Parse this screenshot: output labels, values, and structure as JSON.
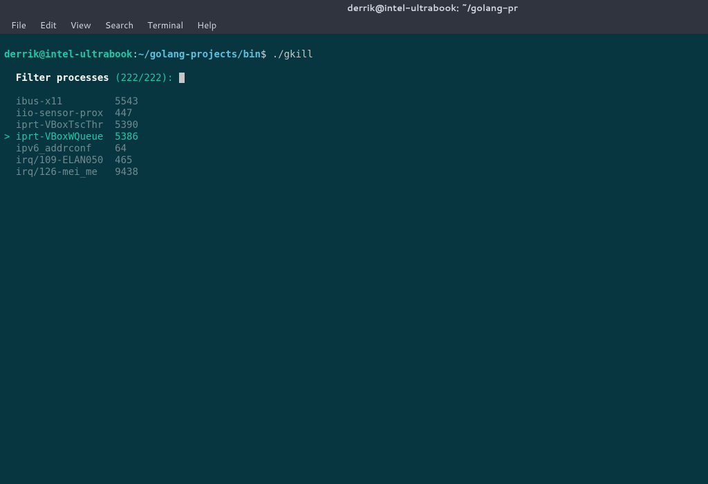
{
  "titlebar": {
    "text": "derrik@intel-ultrabook: ~/golang-pr"
  },
  "menubar": {
    "items": [
      "File",
      "Edit",
      "View",
      "Search",
      "Terminal",
      "Help"
    ]
  },
  "prompt": {
    "user_host": "derrik@intel-ultrabook",
    "colon": ":",
    "path": "~/golang-projects/bin",
    "dollar": "$",
    "command": "./gkill"
  },
  "filter": {
    "label": "Filter processes",
    "count": "(222/222):"
  },
  "processes": [
    {
      "marker": " ",
      "name": "ibus-x11",
      "pid": "5543",
      "selected": false
    },
    {
      "marker": " ",
      "name": "iio-sensor-prox",
      "pid": "447",
      "selected": false
    },
    {
      "marker": " ",
      "name": "iprt-VBoxTscThr",
      "pid": "5390",
      "selected": false
    },
    {
      "marker": ">",
      "name": "iprt-VBoxWQueue",
      "pid": "5386",
      "selected": true
    },
    {
      "marker": " ",
      "name": "ipv6_addrconf",
      "pid": "64",
      "selected": false
    },
    {
      "marker": " ",
      "name": "irq/109-ELAN050",
      "pid": "465",
      "selected": false
    },
    {
      "marker": " ",
      "name": "irq/126-mei_me",
      "pid": "9438",
      "selected": false
    }
  ]
}
